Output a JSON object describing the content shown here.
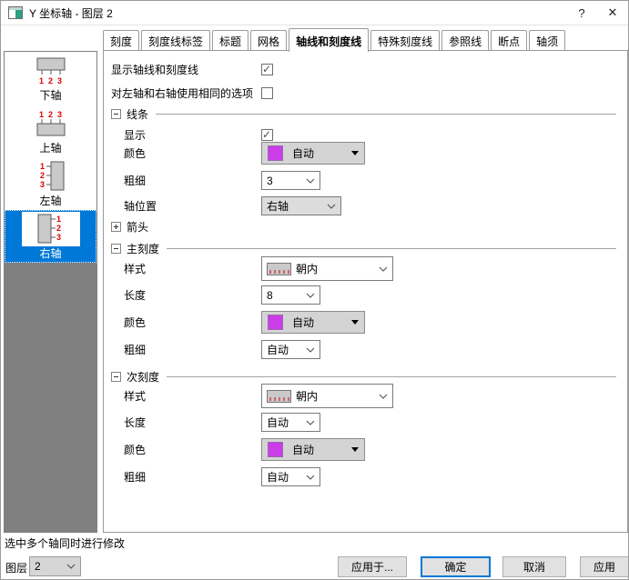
{
  "window": {
    "title": "Y 坐标轴 - 图层 2",
    "help": "?",
    "close": "✕"
  },
  "tabs": [
    {
      "label": "刻度",
      "active": false
    },
    {
      "label": "刻度线标签",
      "active": false
    },
    {
      "label": "标题",
      "active": false
    },
    {
      "label": "网格",
      "active": false
    },
    {
      "label": "轴线和刻度线",
      "active": true
    },
    {
      "label": "特殊刻度线",
      "active": false
    },
    {
      "label": "参照线",
      "active": false
    },
    {
      "label": "断点",
      "active": false
    },
    {
      "label": "轴须",
      "active": false
    }
  ],
  "sidebar": {
    "items": [
      {
        "label": "下轴",
        "selected": false
      },
      {
        "label": "上轴",
        "selected": false
      },
      {
        "label": "左轴",
        "selected": false
      },
      {
        "label": "右轴",
        "selected": true
      }
    ]
  },
  "main": {
    "show_axis_label": "显示轴线和刻度线",
    "show_axis_checked": true,
    "same_options_label": "对左轴和右轴使用相同的选项",
    "same_options_checked": false,
    "line": {
      "title": "线条",
      "show_label": "显示",
      "show_checked": true,
      "color_label": "颜色",
      "color_value": "自动",
      "width_label": "粗细",
      "width_value": "3",
      "position_label": "轴位置",
      "position_value": "右轴",
      "arrow_label": "箭头"
    },
    "major": {
      "title": "主刻度",
      "style_label": "样式",
      "style_value": "朝内",
      "length_label": "长度",
      "length_value": "8",
      "color_label": "颜色",
      "color_value": "自动",
      "width_label": "粗细",
      "width_value": "自动"
    },
    "minor": {
      "title": "次刻度",
      "style_label": "样式",
      "style_value": "朝内",
      "length_label": "长度",
      "length_value": "自动",
      "color_label": "颜色",
      "color_value": "自动",
      "width_label": "粗细",
      "width_value": "自动"
    }
  },
  "footer": {
    "status": "选中多个轴同时进行修改",
    "layer_label": "图层",
    "layer_value": "2",
    "apply_to": "应用于...",
    "ok": "确定",
    "cancel": "取消",
    "apply": "应用"
  },
  "colors": {
    "accent_blue": "#0078d7",
    "auto_swatch": "#cc3ce8",
    "sidebar_fill": "#808080"
  }
}
